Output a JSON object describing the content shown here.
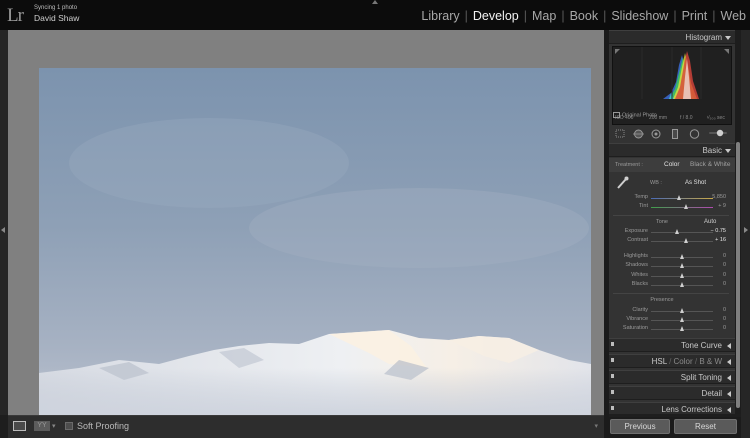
{
  "app": {
    "logo": "Lr",
    "sync_status": "Syncing 1 photo",
    "user_name": "David Shaw"
  },
  "modules": [
    {
      "label": "Library",
      "active": false
    },
    {
      "label": "Develop",
      "active": true
    },
    {
      "label": "Map",
      "active": false
    },
    {
      "label": "Book",
      "active": false
    },
    {
      "label": "Slideshow",
      "active": false
    },
    {
      "label": "Print",
      "active": false
    },
    {
      "label": "Web",
      "active": false
    }
  ],
  "histogram": {
    "title": "Histogram",
    "iso": "ISO 400",
    "focal_length": "200 mm",
    "aperture": "f / 8.0",
    "shutter": "¹⁄₅₀₀ sec",
    "original_photo": "Original Photo"
  },
  "basic": {
    "title": "Basic",
    "treatment_label": "Treatment :",
    "color_option": "Color",
    "bw_option": "Black & White",
    "wb_label": "WB :",
    "wb_value": "As Shot",
    "temp": {
      "label": "Temp",
      "value": "5,850",
      "position": 0.46
    },
    "tint": {
      "label": "Tint",
      "value": "+ 9",
      "position": 0.57
    },
    "tone_label": "Tone",
    "auto_label": "Auto",
    "exposure": {
      "label": "Exposure",
      "value": "− 0.75",
      "position": 0.43
    },
    "contrast": {
      "label": "Contrast",
      "value": "+ 16",
      "position": 0.58
    },
    "highlights": {
      "label": "Highlights",
      "value": "0",
      "position": 0.5
    },
    "shadows": {
      "label": "Shadows",
      "value": "0",
      "position": 0.5
    },
    "whites": {
      "label": "Whites",
      "value": "0",
      "position": 0.5
    },
    "blacks": {
      "label": "Blacks",
      "value": "0",
      "position": 0.5
    },
    "presence_label": "Presence",
    "clarity": {
      "label": "Clarity",
      "value": "0",
      "position": 0.5
    },
    "vibrance": {
      "label": "Vibrance",
      "value": "0",
      "position": 0.5
    },
    "saturation": {
      "label": "Saturation",
      "value": "0",
      "position": 0.5
    }
  },
  "panels": {
    "tone_curve": "Tone Curve",
    "hsl": "HSL",
    "color": "Color",
    "bw": "B & W",
    "split_toning": "Split Toning",
    "detail": "Detail",
    "lens_corrections": "Lens Corrections"
  },
  "toolbar": {
    "soft_proofing": "Soft Proofing",
    "before_after": "YY"
  },
  "buttons": {
    "previous": "Previous",
    "reset": "Reset"
  }
}
